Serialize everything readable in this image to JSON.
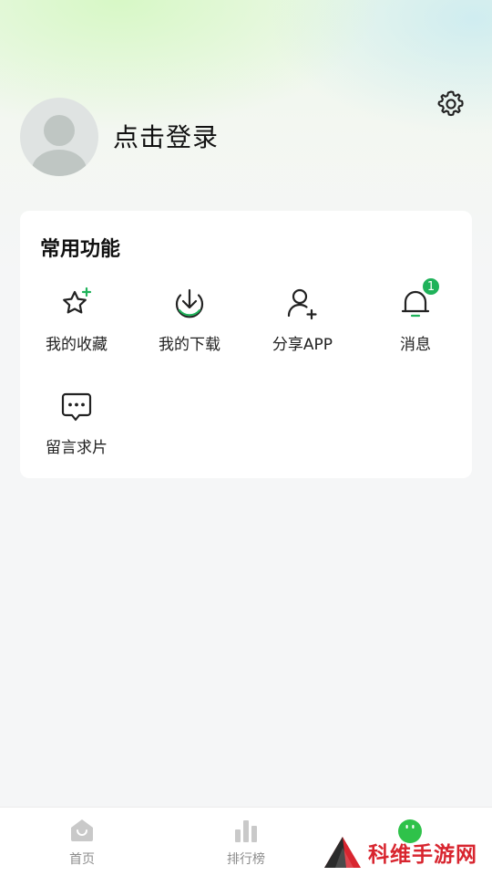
{
  "profile": {
    "login_text": "点击登录",
    "avatar_icon": "user-avatar-icon",
    "settings_icon": "gear-icon"
  },
  "features": {
    "title": "常用功能",
    "items": [
      {
        "label": "我的收藏",
        "icon": "star-icon"
      },
      {
        "label": "我的下载",
        "icon": "download-icon"
      },
      {
        "label": "分享APP",
        "icon": "add-user-icon"
      },
      {
        "label": "消息",
        "icon": "bell-icon",
        "badge": "1"
      },
      {
        "label": "留言求片",
        "icon": "chat-icon"
      }
    ]
  },
  "tabbar": {
    "items": [
      {
        "label": "首页",
        "icon": "home-icon"
      },
      {
        "label": "排行榜",
        "icon": "bar-chart-icon"
      },
      {
        "label": "",
        "icon": "mine-face-icon"
      }
    ]
  },
  "watermark": {
    "text": "科维手游网"
  },
  "colors": {
    "accent_green": "#1fb25a",
    "watermark_red": "#d8252f",
    "tab_gray": "#8d8d8d"
  }
}
